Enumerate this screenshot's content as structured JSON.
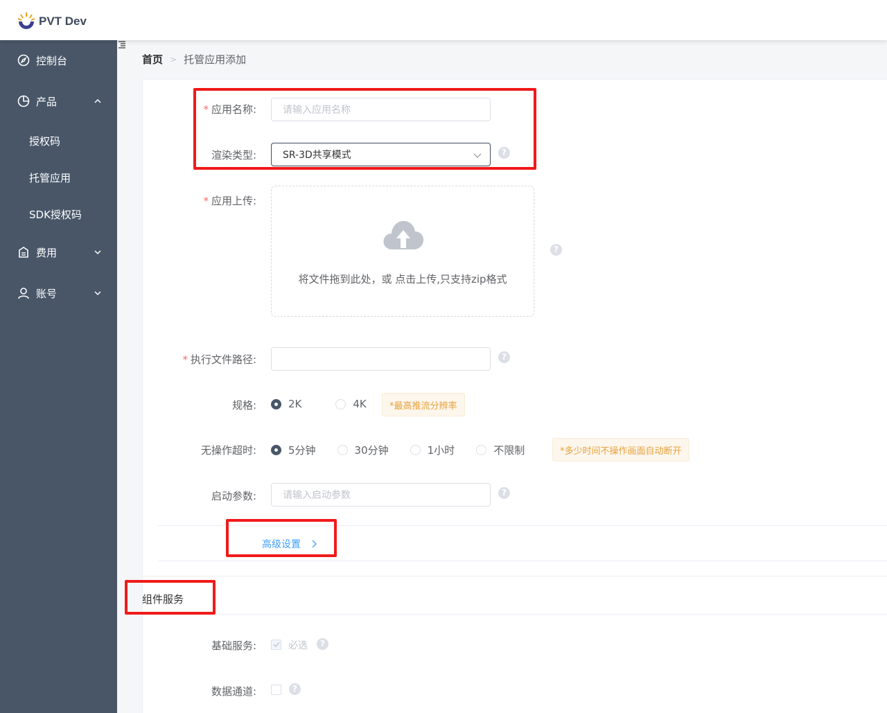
{
  "header": {
    "app_name": "PVT Dev"
  },
  "sidebar": {
    "dashboard": "控制台",
    "product": "产品",
    "product_sub": [
      "授权码",
      "托管应用",
      "SDK授权码"
    ],
    "billing": "费用",
    "account": "账号"
  },
  "breadcrumb": {
    "home": "首页",
    "current": "托管应用添加"
  },
  "form": {
    "app_name_label": "应用名称:",
    "app_name_placeholder": "请输入应用名称",
    "render_type_label": "渲染类型:",
    "render_type_value": "SR-3D共享模式",
    "upload_label": "应用上传:",
    "upload_hint": "将文件拖到此处，或 点击上传,只支持zip格式",
    "exec_path_label": "执行文件路径:",
    "exec_path_value": "",
    "spec_label": "规格:",
    "spec_options": [
      "2K",
      "4K"
    ],
    "spec_selected": "2K",
    "spec_tip": "*最高推流分辨率",
    "timeout_label": "无操作超时:",
    "timeout_options": [
      "5分钟",
      "30分钟",
      "1小时",
      "不限制"
    ],
    "timeout_selected": "5分钟",
    "timeout_tip": "*多少时间不操作画面自动断开",
    "launch_params_label": "启动参数:",
    "launch_params_placeholder": "请输入启动参数",
    "advanced_label": "高级设置"
  },
  "components": {
    "title": "组件服务",
    "basic_label": "基础服务:",
    "basic_text": "必选",
    "basic_checked": true,
    "data_channel_label": "数据通道:",
    "data_channel_checked": false
  },
  "colors": {
    "sidebar_bg": "#485668",
    "highlight": "#f01a1a",
    "link": "#409eff",
    "tip": "#e6a23c"
  }
}
